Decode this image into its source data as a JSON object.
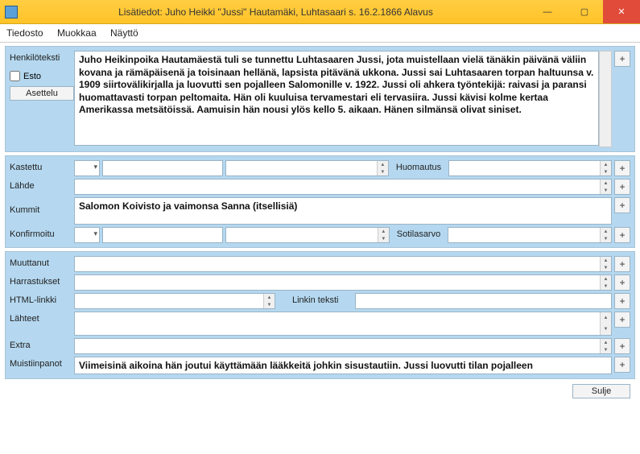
{
  "window": {
    "title": "Lisätiedot: Juho Heikki \"Jussi\" Hautamäki, Luhtasaari  s. 16.2.1866 Alavus"
  },
  "menu": {
    "file": "Tiedosto",
    "edit": "Muokkaa",
    "view": "Näyttö"
  },
  "labels": {
    "henkiloteksti": "Henkilöteksti",
    "esto": "Esto",
    "asettelu": "Asettelu",
    "kastettu": "Kastettu",
    "huomautus": "Huomautus",
    "lahde": "Lähde",
    "kummit": "Kummit",
    "konfirmoitu": "Konfirmoitu",
    "sotilasarvo": "Sotilasarvo",
    "muuttanut": "Muuttanut",
    "harrastukset": "Harrastukset",
    "htmllinkki": "HTML-linkki",
    "linkinteksti": "Linkin teksti",
    "lahteet": "Lähteet",
    "extra": "Extra",
    "muistiinpanot": "Muistiinpanot",
    "sulje": "Sulje",
    "plus": "+"
  },
  "values": {
    "henkiloteksti": "Juho Heikinpoika Hautamäestä tuli se tunnettu Luhtasaaren Jussi, jota muistellaan vielä tänäkin päivänä väliin kovana ja rämäpäisenä ja toisinaan hellänä, lapsista pitävänä ukkona. Jussi sai Luhtasaaren torpan haltuunsa v. 1909 siirtovälikirjalla ja luovutti sen pojalleen Salomonille v. 1922. Jussi oli ahkera työntekijä: raivasi ja paransi huomattavasti torpan peltomaita. Hän oli kuuluisa tervamestari eli tervasiira. Jussi kävisi kolme kertaa Amerikassa metsätöissä. Aamuisin hän nousi ylös kello 5. aikaan. Hänen silmänsä olivat siniset.",
    "kummit": "Salomon Koivisto ja vaimonsa Sanna (itsellisiä)",
    "muistiinpanot": "Viimeisinä aikoina hän joutui käyttämään lääkkeitä johkin sisustautiin. Jussi luovutti tilan pojalleen"
  }
}
